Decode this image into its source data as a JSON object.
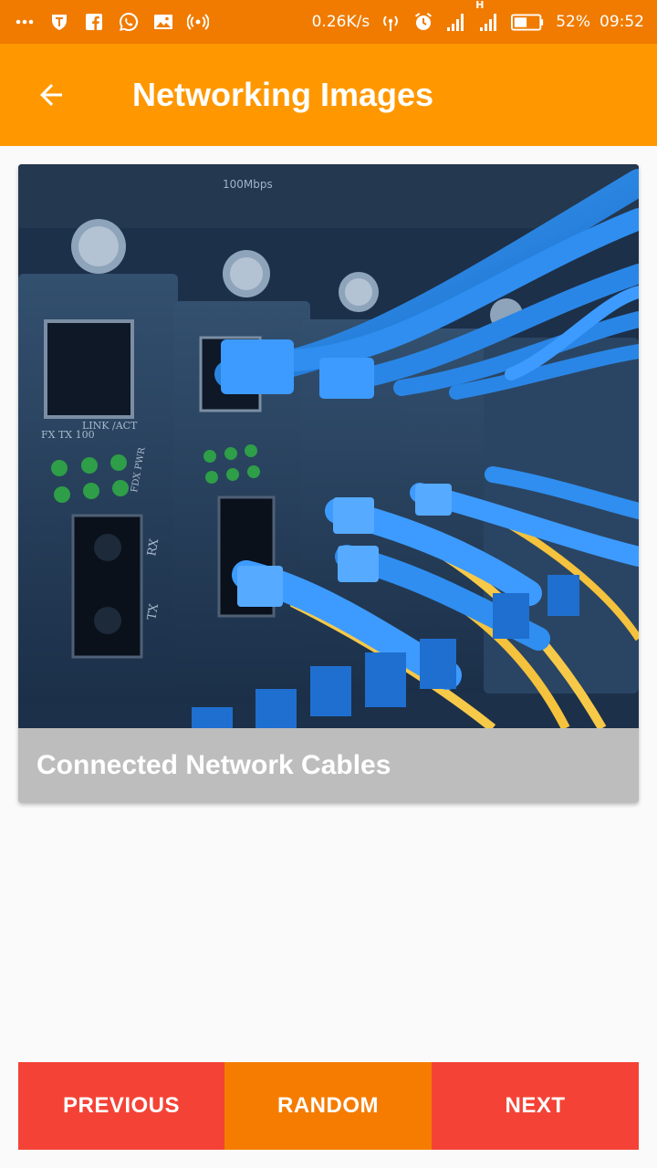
{
  "status_bar": {
    "network_speed": "0.26K/s",
    "network_type": "H",
    "battery": "52%",
    "time": "09:52",
    "icons": [
      "more-icon",
      "shield-icon",
      "facebook-icon",
      "whatsapp-icon",
      "image-icon",
      "hotspot-icon",
      "wireless-icon",
      "alarm-icon",
      "signal-icon",
      "signal-h-icon",
      "battery-icon"
    ]
  },
  "app_bar": {
    "title": "Networking Images",
    "back_icon": "arrow-back-icon",
    "color": "#ff9800"
  },
  "card": {
    "caption": "Connected Network Cables"
  },
  "photo_labels": {
    "speed": "100Mbps",
    "port1_leds": "FX TX 100",
    "port1_link": "LINK /ACT",
    "port1_fdx": "FDX PWR",
    "port1_rx": "RX",
    "port1_tx": "TX"
  },
  "buttons": {
    "previous": "PREVIOUS",
    "random": "RANDOM",
    "next": "NEXT"
  },
  "colors": {
    "status_bar": "#f07b00",
    "primary": "#ff9800",
    "button_red": "#f44336",
    "button_orange": "#f57c00",
    "caption_bg": "#bdbdbd"
  }
}
